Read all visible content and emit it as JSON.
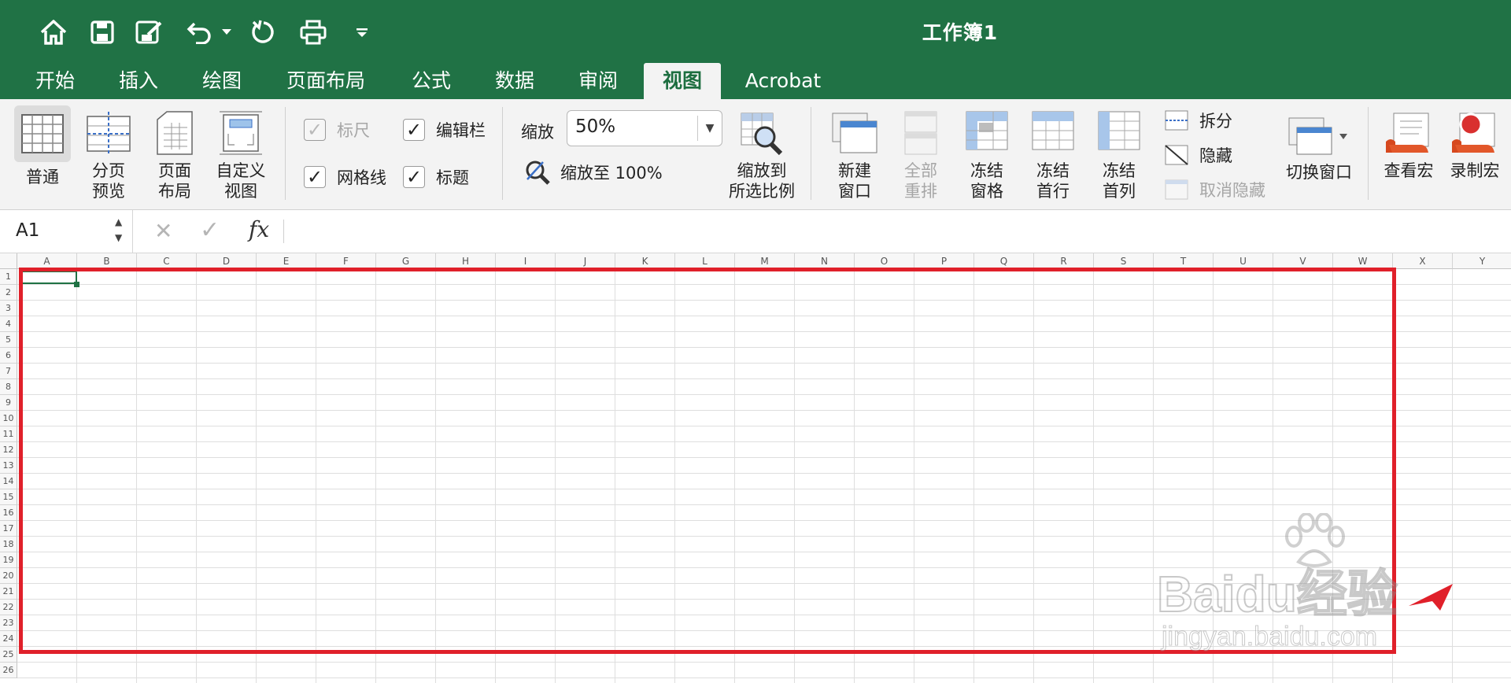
{
  "window": {
    "title": "工作簿1"
  },
  "quick_access": {
    "icons": [
      "home-icon",
      "save-icon",
      "edit-save-icon",
      "undo-icon",
      "undo-dropdown-icon",
      "redo-icon",
      "print-icon",
      "customize-toolbar-icon"
    ]
  },
  "tabs": [
    {
      "label": "开始"
    },
    {
      "label": "插入"
    },
    {
      "label": "绘图"
    },
    {
      "label": "页面布局"
    },
    {
      "label": "公式"
    },
    {
      "label": "数据"
    },
    {
      "label": "审阅"
    },
    {
      "label": "视图",
      "active": true
    },
    {
      "label": "Acrobat"
    }
  ],
  "ribbon": {
    "views": [
      {
        "line1": "普通",
        "line2": ""
      },
      {
        "line1": "分页",
        "line2": "预览"
      },
      {
        "line1": "页面",
        "line2": "布局"
      },
      {
        "line1": "自定义",
        "line2": "视图"
      }
    ],
    "show": {
      "ruler": {
        "label": "标尺",
        "checked": true,
        "disabled": true
      },
      "formula_bar": {
        "label": "编辑栏",
        "checked": true
      },
      "gridlines": {
        "label": "网格线",
        "checked": true
      },
      "headings": {
        "label": "标题",
        "checked": true
      }
    },
    "zoom": {
      "label": "缩放",
      "value": "50%",
      "zoom100": "缩放至 100%",
      "to_selection_line1": "缩放到",
      "to_selection_line2": "所选比例"
    },
    "window": {
      "new_window": {
        "line1": "新建",
        "line2": "窗口"
      },
      "arrange_all": {
        "line1": "全部",
        "line2": "重排"
      },
      "freeze_panes": {
        "line1": "冻结",
        "line2": "窗格"
      },
      "freeze_top_row": {
        "line1": "冻结",
        "line2": "首行"
      },
      "freeze_first_col": {
        "line1": "冻结",
        "line2": "首列"
      },
      "split": "拆分",
      "hide": "隐藏",
      "unhide": "取消隐藏",
      "switch_windows": "切换窗口"
    },
    "macros": {
      "view": "查看宏",
      "record": "录制宏"
    }
  },
  "formula_bar": {
    "cell_ref": "A1",
    "cancel": "✕",
    "enter": "✓",
    "fx": "fx",
    "formula": ""
  },
  "sheet": {
    "columns": [
      "A",
      "B",
      "C",
      "D",
      "E",
      "F",
      "G",
      "H",
      "I",
      "J",
      "K",
      "L",
      "M",
      "N",
      "O",
      "P",
      "Q",
      "R",
      "S",
      "T",
      "U",
      "V",
      "W",
      "X",
      "Y"
    ],
    "rows": [
      "1",
      "2",
      "3",
      "4",
      "5",
      "6",
      "7",
      "8",
      "9",
      "10",
      "11",
      "12",
      "13",
      "14",
      "15",
      "16",
      "17",
      "18",
      "19",
      "20",
      "21",
      "22",
      "23",
      "24",
      "25",
      "26"
    ],
    "selected_cell": "A1"
  },
  "watermark": {
    "brand": "Baidu经验",
    "url": "jingyan.baidu.com"
  },
  "colors": {
    "excel_green": "#207245",
    "highlight_red": "#e0202a",
    "selection_green": "#1f7244"
  }
}
